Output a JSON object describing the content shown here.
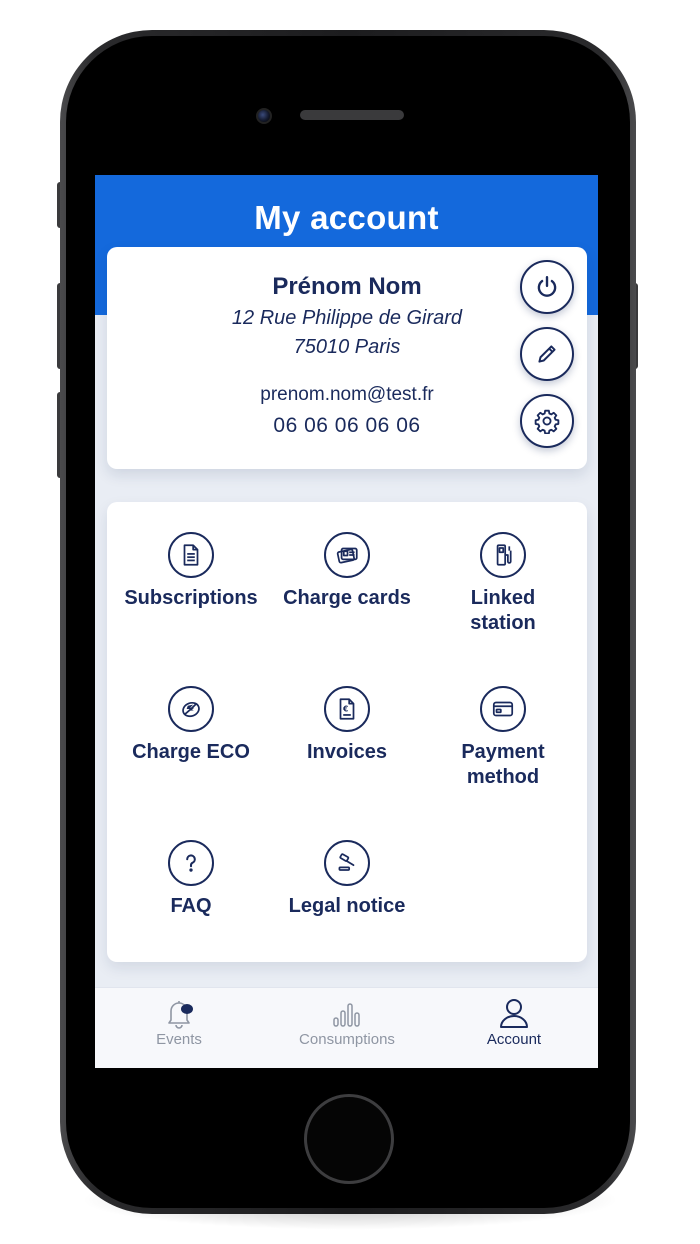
{
  "header": {
    "title": "My account"
  },
  "profile": {
    "name": "Prénom Nom",
    "address_line1": "12 Rue Philippe de Girard",
    "address_line2": "75010 Paris",
    "email": "prenom.nom@test.fr",
    "phone": "06 06 06 06 06",
    "actions": [
      "power-icon",
      "pencil-icon",
      "gear-icon"
    ]
  },
  "menu": {
    "items": [
      {
        "label": "Subscriptions",
        "icon": "document-icon"
      },
      {
        "label": "Charge cards",
        "icon": "card-stack-icon"
      },
      {
        "label": "Linked\nstation",
        "icon": "charging-station-icon"
      },
      {
        "label": "Charge ECO",
        "icon": "eco-leaf-icon"
      },
      {
        "label": "Invoices",
        "icon": "invoice-icon"
      },
      {
        "label": "Payment\nmethod",
        "icon": "credit-card-icon"
      },
      {
        "label": "FAQ",
        "icon": "question-mark-icon"
      },
      {
        "label": "Legal notice",
        "icon": "gavel-icon"
      }
    ]
  },
  "tabbar": {
    "tabs": [
      {
        "label": "Events",
        "icon": "bell-icon",
        "active": false
      },
      {
        "label": "Consumptions",
        "icon": "bar-chart-icon",
        "active": false
      },
      {
        "label": "Account",
        "icon": "user-icon",
        "active": true
      }
    ]
  },
  "colors": {
    "header": "#1469dc",
    "navy": "#1a2a5c",
    "background": "#e9edf4",
    "inactive_tab": "#8f96a3"
  }
}
